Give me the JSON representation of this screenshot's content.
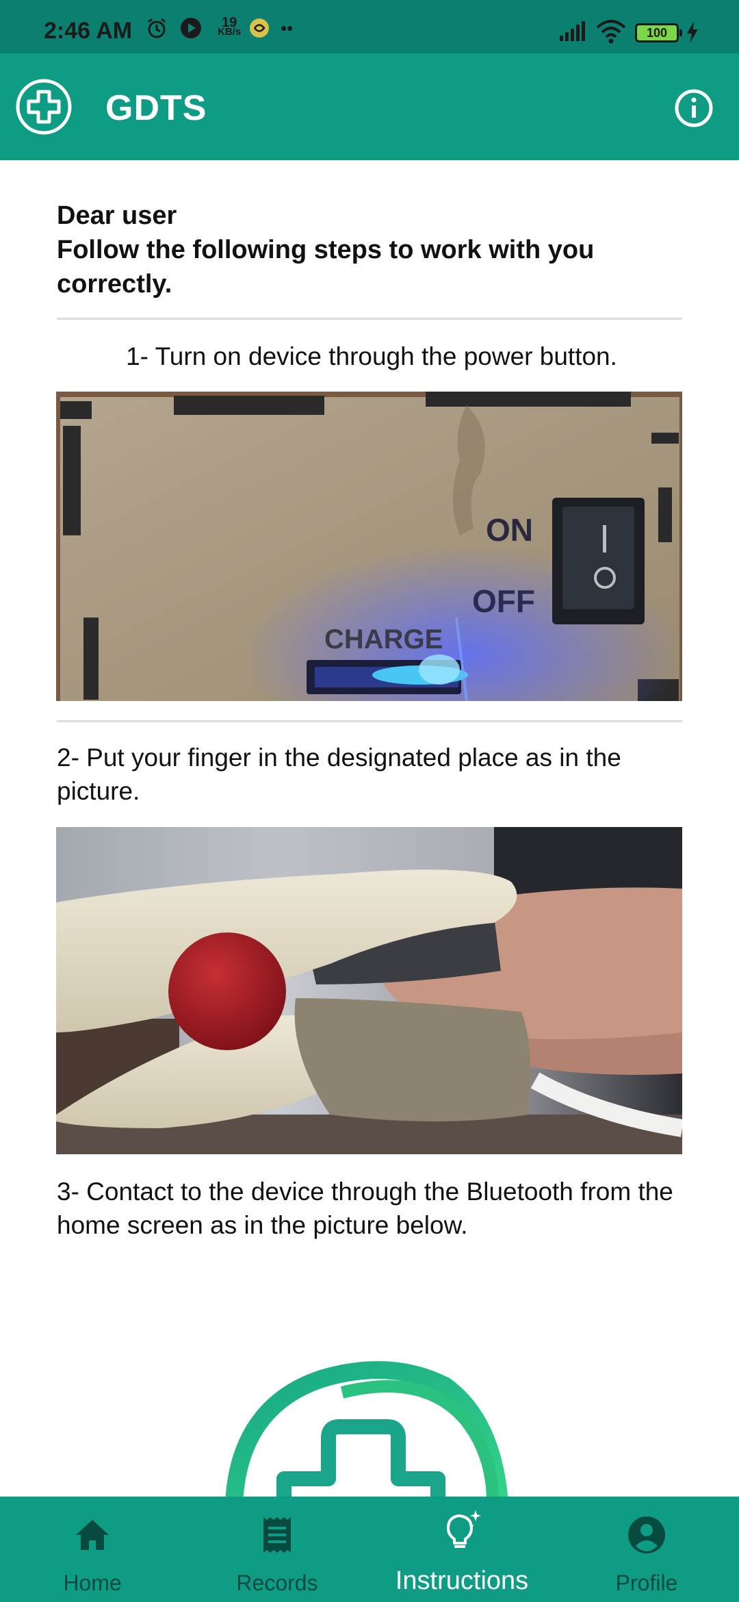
{
  "status_bar": {
    "time": "2:46 AM",
    "net_speed_value": "19",
    "net_speed_unit": "KB/s",
    "dots": "••",
    "battery": "100"
  },
  "app_bar": {
    "title": "GDTS"
  },
  "content": {
    "greeting_line1": "Dear user",
    "greeting_line2": "Follow the following steps to work with you correctly.",
    "step1": "1- Turn on  device through the power button.",
    "step1_photo_labels": [
      "ON",
      "OFF",
      "CHARGE"
    ],
    "step2": "2- Put your finger in the designated place as in the picture.",
    "step3": "3- Contact to the device through the Bluetooth from the home screen as in the picture below."
  },
  "bottom_nav": {
    "items": [
      {
        "label": "Home",
        "icon": "home-icon"
      },
      {
        "label": "Records",
        "icon": "receipt-icon"
      },
      {
        "label": "Instructions",
        "icon": "lightbulb-icon"
      },
      {
        "label": "Profile",
        "icon": "profile-icon"
      }
    ],
    "active": "Instructions"
  },
  "colors": {
    "status_bar": "#0b7f70",
    "primary": "#0e9c85",
    "nav_inactive": "#064a40",
    "nav_active": "#ffffff"
  }
}
